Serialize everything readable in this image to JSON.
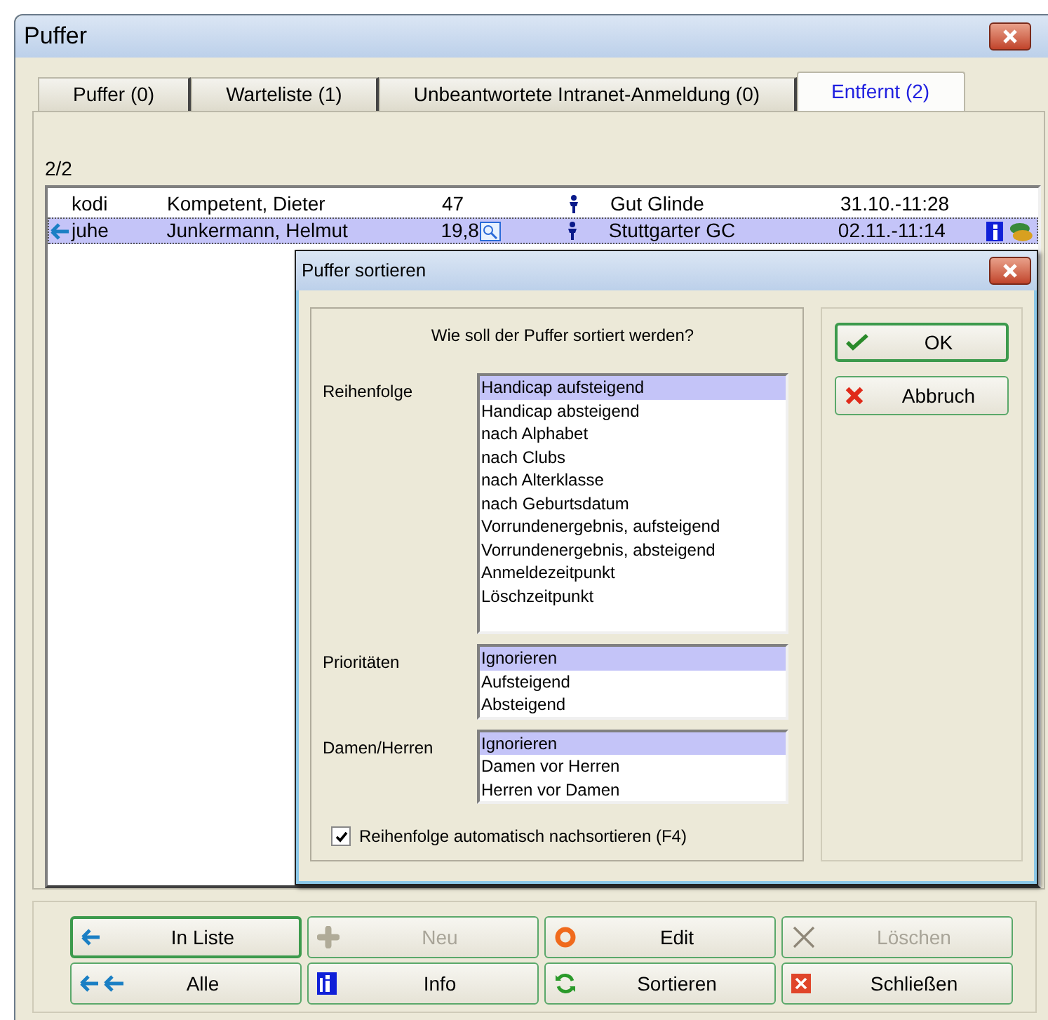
{
  "window": {
    "title": "Puffer"
  },
  "tabs": [
    {
      "label": "Puffer (0)",
      "selected": false
    },
    {
      "label": "Warteliste (1)",
      "selected": false
    },
    {
      "label": "Unbeantwortete Intranet-Anmeldung (0)",
      "selected": false
    },
    {
      "label": "Entfernt (2)",
      "selected": true
    }
  ],
  "count": "2/2",
  "rows": [
    {
      "code": "kodi",
      "name": "Kompetent, Dieter",
      "handicap": "47",
      "has_note": false,
      "club": "Gut Glinde",
      "time": "31.10.-11:28",
      "selected": false
    },
    {
      "code": "juhe",
      "name": "Junkermann, Helmut",
      "handicap": "19,8",
      "has_note": true,
      "club": "Stuttgarter GC",
      "time": "02.11.-11:14",
      "selected": true
    }
  ],
  "dialog": {
    "title": "Puffer sortieren",
    "question": "Wie soll der Puffer sortiert werden?",
    "groups": [
      {
        "label": "Reihenfolge",
        "items": [
          {
            "label": "Handicap aufsteigend",
            "selected": true
          },
          {
            "label": "Handicap absteigend",
            "selected": false
          },
          {
            "label": "nach Alphabet",
            "selected": false
          },
          {
            "label": "nach Clubs",
            "selected": false
          },
          {
            "label": "nach Alterklasse",
            "selected": false
          },
          {
            "label": "nach Geburtsdatum",
            "selected": false
          },
          {
            "label": "Vorrundenergebnis, aufsteigend",
            "selected": false
          },
          {
            "label": "Vorrundenergebnis, absteigend",
            "selected": false
          },
          {
            "label": "Anmeldezeitpunkt",
            "selected": false
          },
          {
            "label": "Löschzeitpunkt",
            "selected": false
          }
        ]
      },
      {
        "label": "Prioritäten",
        "items": [
          {
            "label": "Ignorieren",
            "selected": true
          },
          {
            "label": "Aufsteigend",
            "selected": false
          },
          {
            "label": "Absteigend",
            "selected": false
          }
        ]
      },
      {
        "label": "Damen/Herren",
        "items": [
          {
            "label": "Ignorieren",
            "selected": true
          },
          {
            "label": "Damen vor Herren",
            "selected": false
          },
          {
            "label": "Herren vor Damen",
            "selected": false
          }
        ]
      }
    ],
    "checkbox": {
      "label": "Reihenfolge automatisch nachsortieren (F4)",
      "checked": true
    },
    "buttons": [
      {
        "label": "OK",
        "kind": "ok",
        "focused": true
      },
      {
        "label": "Abbruch",
        "kind": "cancel",
        "focused": false
      }
    ]
  },
  "buttons": [
    {
      "label": "In Liste",
      "kind": "left",
      "disabled": false,
      "focused": true
    },
    {
      "label": "Neu",
      "kind": "plus",
      "disabled": true,
      "focused": false
    },
    {
      "label": "Edit",
      "kind": "ring",
      "disabled": false,
      "focused": false
    },
    {
      "label": "Löschen",
      "kind": "cross",
      "disabled": true,
      "focused": false
    },
    {
      "label": "Alle",
      "kind": "leftleft",
      "disabled": false,
      "focused": false
    },
    {
      "label": "Info",
      "kind": "info",
      "disabled": false,
      "focused": false
    },
    {
      "label": "Sortieren",
      "kind": "refresh",
      "disabled": false,
      "focused": false
    },
    {
      "label": "Schließen",
      "kind": "close",
      "disabled": false,
      "focused": false
    }
  ]
}
